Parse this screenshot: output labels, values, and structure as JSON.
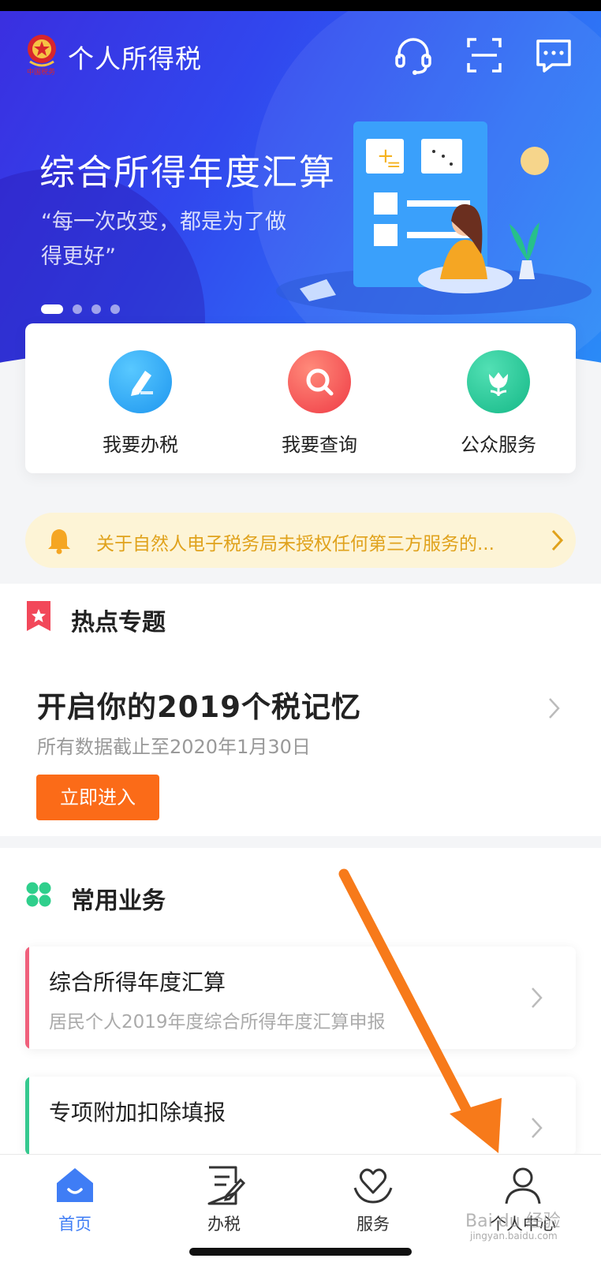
{
  "app": {
    "title": "个人所得税"
  },
  "banner": {
    "title": "综合所得年度汇算",
    "quote": "“每一次改变，都是为了做得更好”",
    "page_count": 4,
    "active_page": 1
  },
  "quick_actions": [
    {
      "label": "我要办税",
      "icon": "pencil-icon",
      "color": "#2aa6f5"
    },
    {
      "label": "我要查询",
      "icon": "search-icon",
      "color": "#f4514f"
    },
    {
      "label": "公众服务",
      "icon": "tulip-icon",
      "color": "#1fc79b"
    }
  ],
  "notice": {
    "text": "关于自然人电子税务局未授权任何第三方服务的..."
  },
  "hot_topics": {
    "section_title": "热点专题",
    "title": "开启你的2019个税记忆",
    "subtitle": "所有数据截止至2020年1月30日",
    "button_label": "立即进入"
  },
  "common_business": {
    "section_title": "常用业务",
    "items": [
      {
        "title": "综合所得年度汇算",
        "subtitle": "居民个人2019年度综合所得年度汇算申报",
        "accent": "#f0607c"
      },
      {
        "title": "专项附加扣除填报",
        "subtitle": "",
        "accent": "#35c98f"
      }
    ]
  },
  "tabbar": {
    "items": [
      {
        "label": "首页",
        "icon": "home-icon",
        "active": true
      },
      {
        "label": "办税",
        "icon": "document-edit-icon",
        "active": false
      },
      {
        "label": "服务",
        "icon": "heart-hands-icon",
        "active": false
      },
      {
        "label": "个人中心",
        "icon": "person-icon",
        "active": false
      }
    ]
  },
  "colors": {
    "primary": "#3f7df5",
    "orange": "#fb6b18",
    "notice": "#e0a21c"
  },
  "watermark": {
    "text": "Bai du 经验",
    "sub": "jingyan.baidu.com"
  }
}
